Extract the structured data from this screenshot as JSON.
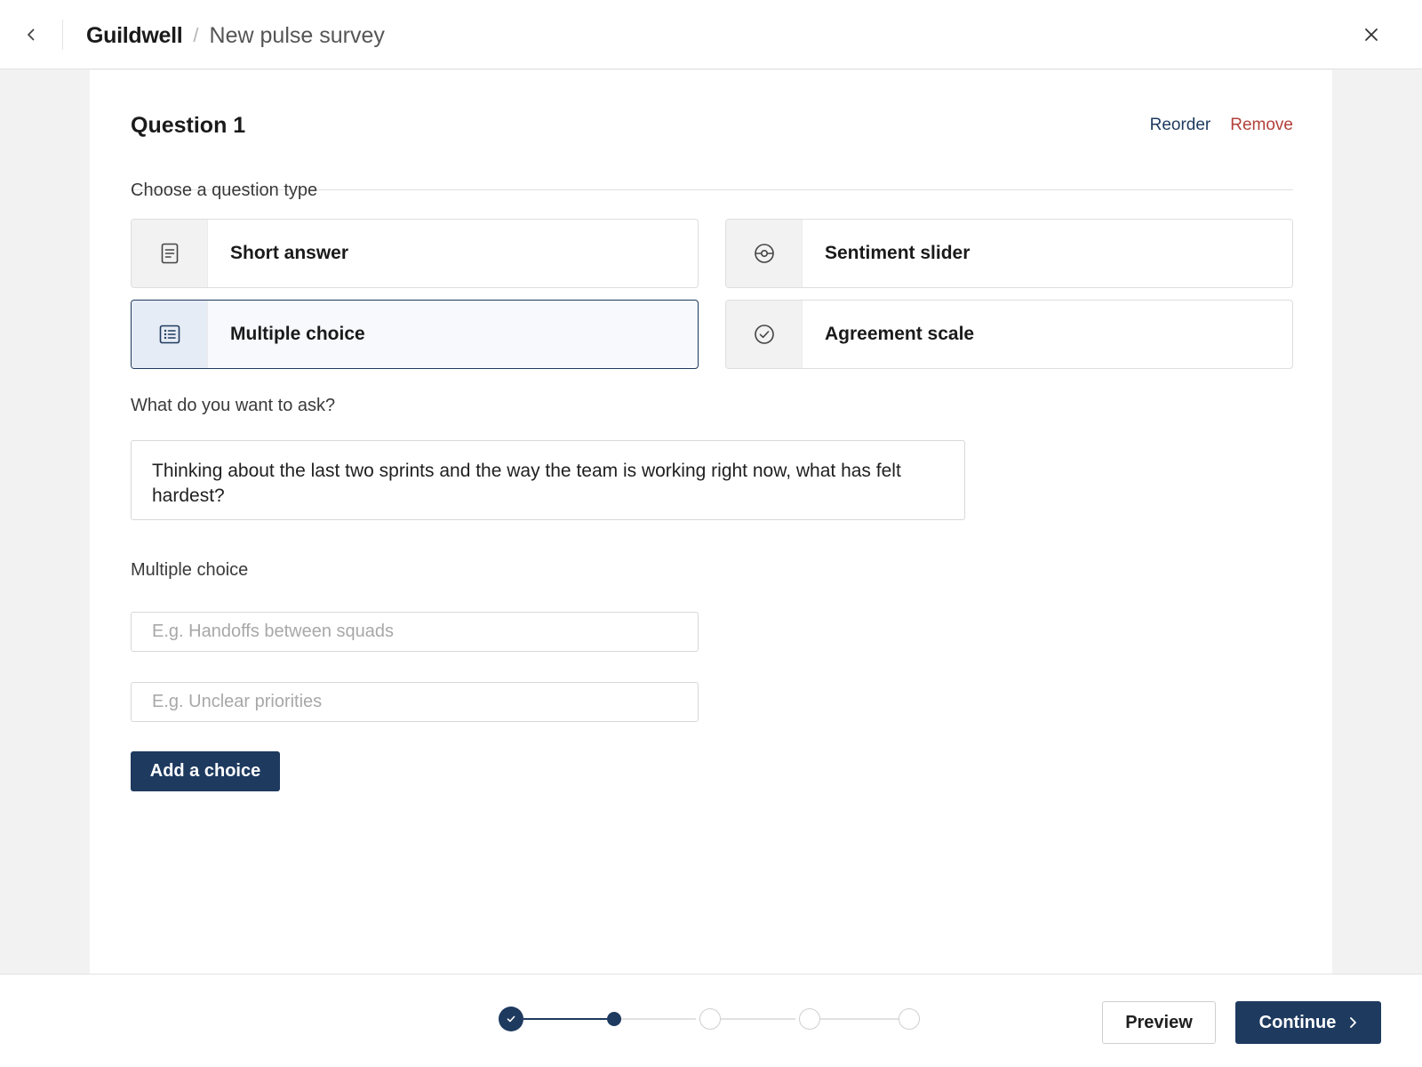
{
  "header": {
    "brand": "Guildwell",
    "separator": "/",
    "page_title": "New pulse survey",
    "back_icon": "chevron-left-icon",
    "close_icon": "close-icon"
  },
  "question": {
    "title": "Question 1",
    "reorder_label": "Reorder",
    "remove_label": "Remove",
    "type_prompt": "Choose a question type",
    "types": [
      {
        "label": "Short answer",
        "icon": "document-icon",
        "selected": false
      },
      {
        "label": "Sentiment slider",
        "icon": "target-icon",
        "selected": false
      },
      {
        "label": "Multiple choice",
        "icon": "list-icon",
        "selected": true
      },
      {
        "label": "Agreement scale",
        "icon": "check-circle-icon",
        "selected": false
      }
    ],
    "ask_label": "What do you want to ask?",
    "ask_value": "Thinking about the last two sprints and the way the team is working right now, what has felt hardest?",
    "choices_label": "Multiple choice",
    "choices": [
      {
        "value": "",
        "placeholder": "E.g. Handoffs between squads"
      },
      {
        "value": "",
        "placeholder": "E.g. Unclear priorities"
      }
    ],
    "add_choice_label": "Add a choice"
  },
  "footer": {
    "steps_total": 5,
    "steps_completed": 1,
    "current_step": 2,
    "preview_label": "Preview",
    "continue_label": "Continue"
  },
  "colors": {
    "primary": "#1e3a5f",
    "danger": "#b2403a",
    "background": "#f2f2f2"
  }
}
